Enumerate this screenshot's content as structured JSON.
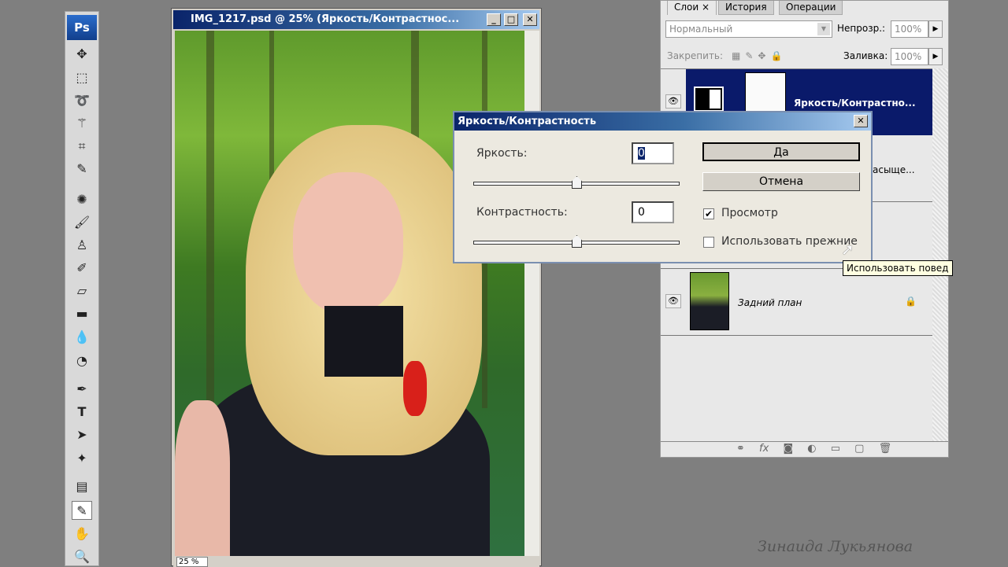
{
  "app": {
    "logo": "Ps"
  },
  "toolbar": {
    "tools": [
      "move",
      "marquee",
      "lasso",
      "magic-wand",
      "crop",
      "eyedropper",
      "healing",
      "brush",
      "stamp",
      "history-brush",
      "eraser",
      "gradient",
      "blur",
      "dodge",
      "pen",
      "type",
      "path-select",
      "shape",
      "notes",
      "eyedropper-active",
      "hand",
      "zoom"
    ]
  },
  "document": {
    "title": "IMG_1217.psd @ 25% (Яркость/Контрастнос...",
    "zoom": "25 %"
  },
  "layers_panel": {
    "tabs": [
      "Слои",
      "История",
      "Операции"
    ],
    "blend_mode": "Нормальный",
    "opacity_label": "Непрозр.:",
    "opacity": "100%",
    "lock_label": "Закрепить:",
    "fill_label": "Заливка:",
    "fill": "100%",
    "layers": [
      {
        "name": "Яркость/Контрастно...",
        "selected": true
      },
      {
        "name": "асыще..."
      },
      {
        "name": "Задний план",
        "locked": true
      }
    ],
    "colors": {
      "selected": "#0a1a6a"
    }
  },
  "dialog": {
    "title": "Яркость/Контрастность",
    "brightness_label": "Яркость:",
    "brightness": "0",
    "contrast_label": "Контрастность:",
    "contrast": "0",
    "ok": "Да",
    "cancel": "Отмена",
    "preview_label": "Просмотр",
    "preview_checked": true,
    "legacy_label": "Использовать прежние",
    "legacy_checked": false
  },
  "tooltip": "Использовать повед",
  "watermark": "Зинаида Лукьянова"
}
